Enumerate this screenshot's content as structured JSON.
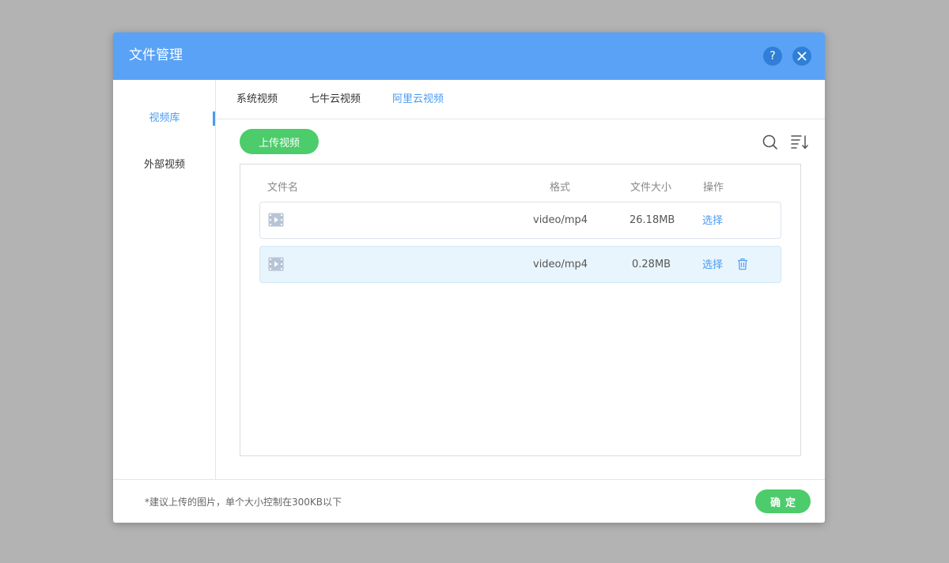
{
  "dialog": {
    "title": "文件管理",
    "help_icon": "question-mark-icon",
    "close_icon": "close-icon",
    "help_label": "?"
  },
  "sidebar": {
    "items": [
      {
        "label": "视频库",
        "active": true
      },
      {
        "label": "外部视频",
        "active": false
      }
    ]
  },
  "tabs": [
    {
      "label": "系统视频",
      "active": false
    },
    {
      "label": "七牛云视频",
      "active": false
    },
    {
      "label": "阿里云视频",
      "active": true
    }
  ],
  "toolbar": {
    "upload_label": "上传视频",
    "search_icon": "search-icon",
    "sort_icon": "sort-icon"
  },
  "table": {
    "columns": [
      "文件名",
      "格式",
      "文件大小",
      "操作"
    ],
    "rows": [
      {
        "name": "",
        "format": "video/mp4",
        "size": "26.18MB",
        "action": "选择",
        "icon": "video-file-icon",
        "deletable": false,
        "highlighted": false
      },
      {
        "name": "",
        "format": "video/mp4",
        "size": "0.28MB",
        "action": "选择",
        "icon": "video-file-icon",
        "deletable": true,
        "highlighted": true
      }
    ]
  },
  "footer": {
    "note": "*建议上传的图片，单个大小控制在300KB以下",
    "confirm_label": "确定"
  },
  "colors": {
    "header_bg": "#5aa2f5",
    "accent": "#4a9bf2",
    "primary_button": "#4ccc6a",
    "row_highlight": "#e9f5fd"
  }
}
